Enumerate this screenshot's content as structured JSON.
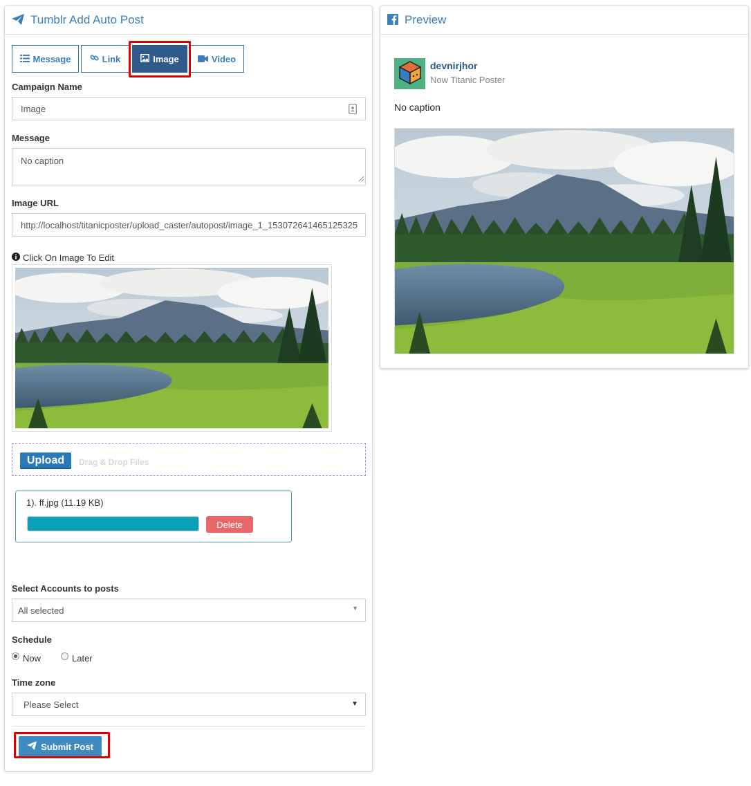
{
  "left_panel": {
    "title": "Tumblr Add Auto Post",
    "title_icon": "paper-plane-icon",
    "tabs": [
      {
        "label": "Message",
        "icon": "list-icon",
        "active": false
      },
      {
        "label": "Link",
        "icon": "link-icon",
        "active": false
      },
      {
        "label": "Image",
        "icon": "image-icon",
        "active": true
      },
      {
        "label": "Video",
        "icon": "video-camera-icon",
        "active": false
      }
    ],
    "campaign_name": {
      "label": "Campaign Name",
      "value": "Image"
    },
    "message": {
      "label": "Message",
      "value": "No caption"
    },
    "image_url": {
      "label": "Image URL",
      "value": "http://localhost/titanicposter/upload_caster/autopost/image_1_153072641465125325"
    },
    "edit_hint": "Click On Image To Edit",
    "upload": {
      "button_label": "Upload",
      "drop_text": "Drag & Drop Files"
    },
    "file": {
      "name": "1). ff.jpg (11.19 KB)",
      "progress": 1.0,
      "delete_label": "Delete"
    },
    "accounts": {
      "label": "Select Accounts to posts",
      "value": "All selected"
    },
    "schedule": {
      "label": "Schedule",
      "options": [
        "Now",
        "Later"
      ],
      "selected": "Now"
    },
    "timezone": {
      "label": "Time zone",
      "value": "Please Select"
    },
    "submit_label": "Submit Post"
  },
  "right_panel": {
    "title": "Preview",
    "title_icon": "facebook-icon",
    "username": "devnirjhor",
    "subtitle": "Now Titanic Poster",
    "caption": "No caption"
  },
  "colors": {
    "accent": "#3d7fb6",
    "tab_active": "#2f5b8c",
    "highlight": "#e00000",
    "progress": "#0aa0b8",
    "delete": "#e8686a",
    "submit": "#3d8bbf"
  }
}
